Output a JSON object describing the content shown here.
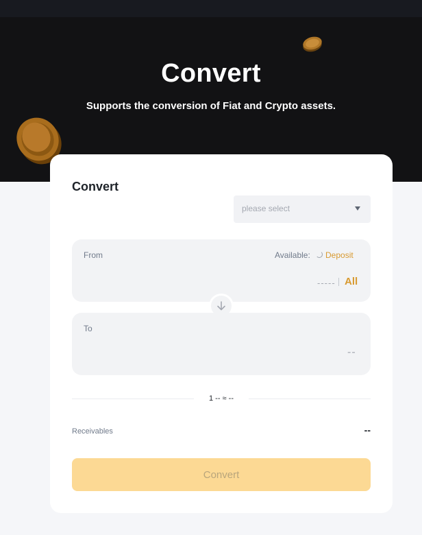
{
  "hero": {
    "title": "Convert",
    "subtitle": "Supports the conversion of Fiat and Crypto assets."
  },
  "card": {
    "title": "Convert",
    "select": {
      "placeholder": "please select"
    },
    "from": {
      "label": "From",
      "available_label": "Available:",
      "deposit_label": "Deposit",
      "amount_placeholder": "-----",
      "all_label": "All"
    },
    "to": {
      "label": "To",
      "amount_value": "--"
    },
    "rate": "1 -- ≈ --",
    "receivables": {
      "label": "Receivables",
      "value": "--"
    },
    "convert_button": "Convert"
  },
  "icons": [
    "coin-icon",
    "chevron-down-icon",
    "arrow-down-icon",
    "loading-spinner-icon"
  ],
  "colors": {
    "hero_bg": "#121214",
    "accent": "#d89a30",
    "button_disabled": "#fcd994",
    "panel_bg": "#f2f3f5"
  }
}
